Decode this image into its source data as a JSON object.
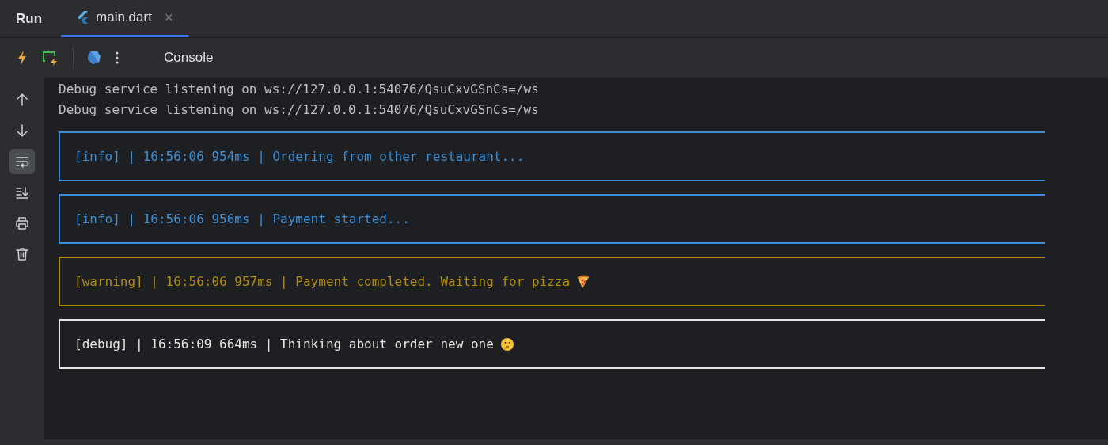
{
  "header": {
    "title": "Run"
  },
  "tabs": [
    {
      "label": "main.dart",
      "selected": true,
      "close": "×"
    }
  ],
  "toolbar": {
    "label": "Console"
  },
  "side_tools": [
    {
      "kind": "up",
      "selected": false
    },
    {
      "kind": "down",
      "selected": false
    },
    {
      "kind": "wrap",
      "selected": true
    },
    {
      "kind": "scroll_end",
      "selected": false
    },
    {
      "kind": "print",
      "selected": false
    },
    {
      "kind": "trash",
      "selected": false
    }
  ],
  "console": {
    "lines": [
      "Debug service listening on ws://127.0.0.1:54076/QsuCxvGSnCs=/ws",
      "Debug service listening on ws://127.0.0.1:54076/QsuCxvGSnCs=/ws"
    ],
    "entries": [
      {
        "kind": "info",
        "text": "[info] | 16:56:06 954ms | Ordering from other restaurant..."
      },
      {
        "kind": "info",
        "text": "[info] | 16:56:06 956ms | Payment started..."
      },
      {
        "kind": "warning",
        "text": "[warning] | 16:56:06 957ms | Payment completed. Waiting for pizza",
        "emoji": {
          "kind": "pizza"
        }
      },
      {
        "kind": "debug",
        "text": "[debug] | 16:56:09 664ms | Thinking about order new one",
        "emoji": {
          "kind": "thinking"
        }
      }
    ]
  }
}
